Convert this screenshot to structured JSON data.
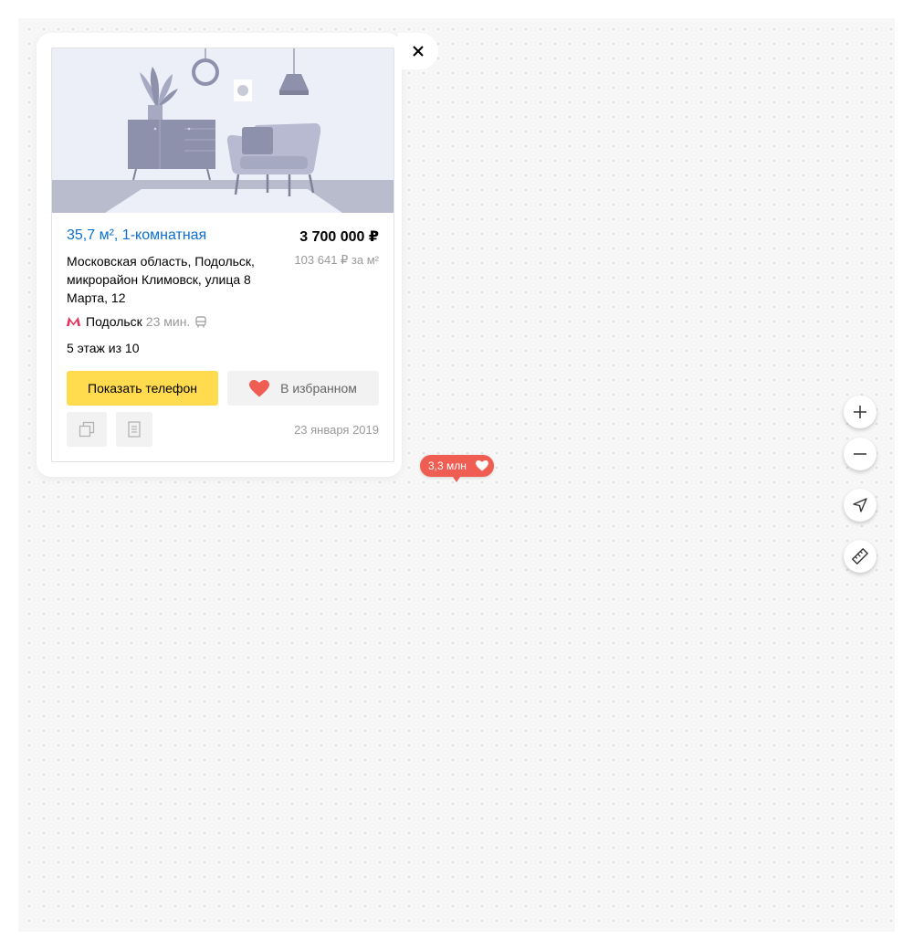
{
  "listing": {
    "title": "35,7 м², 1-комнатная",
    "price": "3 700 000 ₽",
    "price_per_m2": "103 641 ₽ за м²",
    "address": "Московская область, Подольск, микрорайон Климовск, улица 8 Марта, 12",
    "metro": {
      "station": "Подольск",
      "time": "23 мин.",
      "transport_icon": "bus-icon",
      "metro_color": "#e5305b"
    },
    "floor": "5 этаж из 10",
    "date": "23 января 2019",
    "buttons": {
      "phone": "Показать телефон",
      "favorite": "В избранном"
    }
  },
  "map_marker": {
    "label": "3,3 млн",
    "color": "#f05d52"
  },
  "map_controls": [
    "plus-icon",
    "minus-icon",
    "geolocation-icon",
    "ruler-icon"
  ],
  "colors": {
    "link": "#0a6fd0",
    "primary_button": "#ffdb4d",
    "favorite_heart": "#f05d52"
  }
}
